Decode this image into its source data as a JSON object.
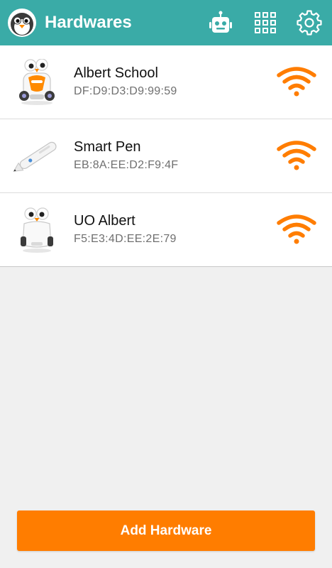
{
  "header": {
    "title": "Hardwares",
    "background": "#3aaba7",
    "icons": [
      "penguin-logo-icon",
      "robot-icon",
      "grid-icon",
      "gear-icon"
    ]
  },
  "devices": [
    {
      "name": "Albert School",
      "address": "DF:D9:D3:D9:99:59",
      "image": "albert-school-robot",
      "signal_icon": "wifi-signal-icon"
    },
    {
      "name": "Smart Pen",
      "address": "EB:8A:EE:D2:F9:4F",
      "image": "smart-pen",
      "signal_icon": "wifi-signal-icon"
    },
    {
      "name": "UO Albert",
      "address": "F5:E3:4D:EE:2E:79",
      "image": "uo-albert-robot",
      "signal_icon": "wifi-signal-icon"
    }
  ],
  "footer": {
    "add_button_label": "Add Hardware",
    "button_color": "#ff7d00"
  },
  "colors": {
    "signal": "#ff7d00",
    "text_primary": "#111111",
    "text_secondary": "#6f6f6f",
    "page_background": "#f0f0f0"
  }
}
